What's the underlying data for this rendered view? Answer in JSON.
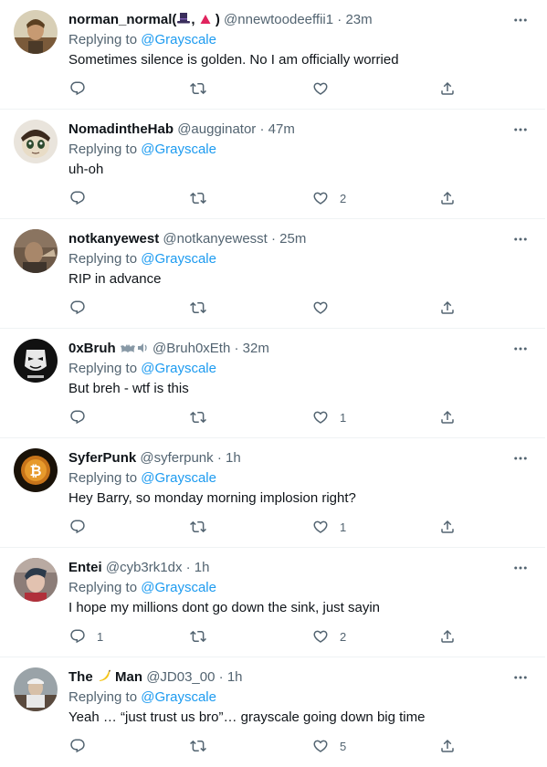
{
  "replying_label": "Replying to",
  "colors": {
    "link": "#1d9bf0",
    "secondary": "#536471",
    "text": "#0f1419",
    "divider": "#eff3f4"
  },
  "tweets": [
    {
      "name": "norman_normal(",
      "name_suffix": ",",
      "name_end": ")",
      "handle": "@nnewtoodeeffii1",
      "sep": "·",
      "time": "23m",
      "reply_to": "@Grayscale",
      "text": "Sometimes silence is golden. No I am officially worried",
      "reply_count": "",
      "retweet_count": "",
      "like_count": ""
    },
    {
      "name": "NomadintheHab",
      "handle": "@augginator",
      "sep": "·",
      "time": "47m",
      "reply_to": "@Grayscale",
      "text": "uh-oh",
      "reply_count": "",
      "retweet_count": "",
      "like_count": "2"
    },
    {
      "name": "notkanyewest",
      "handle": "@notkanyewesst",
      "sep": "·",
      "time": "25m",
      "reply_to": "@Grayscale",
      "text": "RIP in advance",
      "reply_count": "",
      "retweet_count": "",
      "like_count": ""
    },
    {
      "name": "0xBruh",
      "handle": "@Bruh0xEth",
      "sep": "·",
      "time": "32m",
      "reply_to": "@Grayscale",
      "text": "But breh - wtf is this",
      "reply_count": "",
      "retweet_count": "",
      "like_count": "1"
    },
    {
      "name": "SyferPunk",
      "handle": "@syferpunk",
      "sep": "·",
      "time": "1h",
      "reply_to": "@Grayscale",
      "text": "Hey Barry, so monday morning implosion right?",
      "reply_count": "",
      "retweet_count": "",
      "like_count": "1"
    },
    {
      "name": "Entei",
      "handle": "@cyb3rk1dx",
      "sep": "·",
      "time": "1h",
      "reply_to": "@Grayscale",
      "text": "I hope my millions dont go down the sink, just sayin",
      "reply_count": "1",
      "retweet_count": "",
      "like_count": "2"
    },
    {
      "name": "The",
      "name_end": "Man",
      "handle": "@JD03_00",
      "sep": "·",
      "time": "1h",
      "reply_to": "@Grayscale",
      "text": "Yeah … “just trust us bro”… grayscale going down big time",
      "reply_count": "",
      "retweet_count": "",
      "like_count": "5"
    }
  ]
}
